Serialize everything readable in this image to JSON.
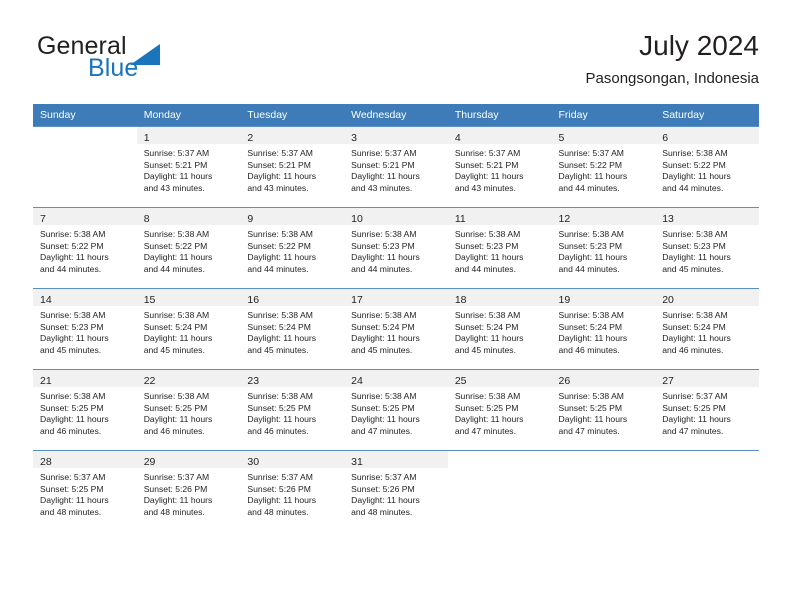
{
  "brand": {
    "name_top": "General",
    "name_bottom": "Blue",
    "colors": {
      "blue": "#1b75bb",
      "dark": "#231f20"
    }
  },
  "header": {
    "title": "July 2024",
    "subtitle": "Pasongsongan, Indonesia"
  },
  "theme": {
    "header_row_bg": "#3d7cb8",
    "daynum_band_bg": "#f1f1f1",
    "grid_line": "#5b8fc4",
    "text": "#231f20"
  },
  "weekday_headers": [
    "Sunday",
    "Monday",
    "Tuesday",
    "Wednesday",
    "Thursday",
    "Friday",
    "Saturday"
  ],
  "labels": {
    "sunrise_prefix": "Sunrise:",
    "sunset_prefix": "Sunset:",
    "daylight_prefix": "Daylight:"
  },
  "weeks": [
    [
      {
        "day": "",
        "blank": true
      },
      {
        "day": "1",
        "sunrise": "Sunrise: 5:37 AM",
        "sunset": "Sunset: 5:21 PM",
        "daylight1": "Daylight: 11 hours",
        "daylight2": "and 43 minutes."
      },
      {
        "day": "2",
        "sunrise": "Sunrise: 5:37 AM",
        "sunset": "Sunset: 5:21 PM",
        "daylight1": "Daylight: 11 hours",
        "daylight2": "and 43 minutes."
      },
      {
        "day": "3",
        "sunrise": "Sunrise: 5:37 AM",
        "sunset": "Sunset: 5:21 PM",
        "daylight1": "Daylight: 11 hours",
        "daylight2": "and 43 minutes."
      },
      {
        "day": "4",
        "sunrise": "Sunrise: 5:37 AM",
        "sunset": "Sunset: 5:21 PM",
        "daylight1": "Daylight: 11 hours",
        "daylight2": "and 43 minutes."
      },
      {
        "day": "5",
        "sunrise": "Sunrise: 5:37 AM",
        "sunset": "Sunset: 5:22 PM",
        "daylight1": "Daylight: 11 hours",
        "daylight2": "and 44 minutes."
      },
      {
        "day": "6",
        "sunrise": "Sunrise: 5:38 AM",
        "sunset": "Sunset: 5:22 PM",
        "daylight1": "Daylight: 11 hours",
        "daylight2": "and 44 minutes."
      }
    ],
    [
      {
        "day": "7",
        "sunrise": "Sunrise: 5:38 AM",
        "sunset": "Sunset: 5:22 PM",
        "daylight1": "Daylight: 11 hours",
        "daylight2": "and 44 minutes."
      },
      {
        "day": "8",
        "sunrise": "Sunrise: 5:38 AM",
        "sunset": "Sunset: 5:22 PM",
        "daylight1": "Daylight: 11 hours",
        "daylight2": "and 44 minutes."
      },
      {
        "day": "9",
        "sunrise": "Sunrise: 5:38 AM",
        "sunset": "Sunset: 5:22 PM",
        "daylight1": "Daylight: 11 hours",
        "daylight2": "and 44 minutes."
      },
      {
        "day": "10",
        "sunrise": "Sunrise: 5:38 AM",
        "sunset": "Sunset: 5:23 PM",
        "daylight1": "Daylight: 11 hours",
        "daylight2": "and 44 minutes."
      },
      {
        "day": "11",
        "sunrise": "Sunrise: 5:38 AM",
        "sunset": "Sunset: 5:23 PM",
        "daylight1": "Daylight: 11 hours",
        "daylight2": "and 44 minutes."
      },
      {
        "day": "12",
        "sunrise": "Sunrise: 5:38 AM",
        "sunset": "Sunset: 5:23 PM",
        "daylight1": "Daylight: 11 hours",
        "daylight2": "and 44 minutes."
      },
      {
        "day": "13",
        "sunrise": "Sunrise: 5:38 AM",
        "sunset": "Sunset: 5:23 PM",
        "daylight1": "Daylight: 11 hours",
        "daylight2": "and 45 minutes."
      }
    ],
    [
      {
        "day": "14",
        "sunrise": "Sunrise: 5:38 AM",
        "sunset": "Sunset: 5:23 PM",
        "daylight1": "Daylight: 11 hours",
        "daylight2": "and 45 minutes."
      },
      {
        "day": "15",
        "sunrise": "Sunrise: 5:38 AM",
        "sunset": "Sunset: 5:24 PM",
        "daylight1": "Daylight: 11 hours",
        "daylight2": "and 45 minutes."
      },
      {
        "day": "16",
        "sunrise": "Sunrise: 5:38 AM",
        "sunset": "Sunset: 5:24 PM",
        "daylight1": "Daylight: 11 hours",
        "daylight2": "and 45 minutes."
      },
      {
        "day": "17",
        "sunrise": "Sunrise: 5:38 AM",
        "sunset": "Sunset: 5:24 PM",
        "daylight1": "Daylight: 11 hours",
        "daylight2": "and 45 minutes."
      },
      {
        "day": "18",
        "sunrise": "Sunrise: 5:38 AM",
        "sunset": "Sunset: 5:24 PM",
        "daylight1": "Daylight: 11 hours",
        "daylight2": "and 45 minutes."
      },
      {
        "day": "19",
        "sunrise": "Sunrise: 5:38 AM",
        "sunset": "Sunset: 5:24 PM",
        "daylight1": "Daylight: 11 hours",
        "daylight2": "and 46 minutes."
      },
      {
        "day": "20",
        "sunrise": "Sunrise: 5:38 AM",
        "sunset": "Sunset: 5:24 PM",
        "daylight1": "Daylight: 11 hours",
        "daylight2": "and 46 minutes."
      }
    ],
    [
      {
        "day": "21",
        "sunrise": "Sunrise: 5:38 AM",
        "sunset": "Sunset: 5:25 PM",
        "daylight1": "Daylight: 11 hours",
        "daylight2": "and 46 minutes."
      },
      {
        "day": "22",
        "sunrise": "Sunrise: 5:38 AM",
        "sunset": "Sunset: 5:25 PM",
        "daylight1": "Daylight: 11 hours",
        "daylight2": "and 46 minutes."
      },
      {
        "day": "23",
        "sunrise": "Sunrise: 5:38 AM",
        "sunset": "Sunset: 5:25 PM",
        "daylight1": "Daylight: 11 hours",
        "daylight2": "and 46 minutes."
      },
      {
        "day": "24",
        "sunrise": "Sunrise: 5:38 AM",
        "sunset": "Sunset: 5:25 PM",
        "daylight1": "Daylight: 11 hours",
        "daylight2": "and 47 minutes."
      },
      {
        "day": "25",
        "sunrise": "Sunrise: 5:38 AM",
        "sunset": "Sunset: 5:25 PM",
        "daylight1": "Daylight: 11 hours",
        "daylight2": "and 47 minutes."
      },
      {
        "day": "26",
        "sunrise": "Sunrise: 5:38 AM",
        "sunset": "Sunset: 5:25 PM",
        "daylight1": "Daylight: 11 hours",
        "daylight2": "and 47 minutes."
      },
      {
        "day": "27",
        "sunrise": "Sunrise: 5:37 AM",
        "sunset": "Sunset: 5:25 PM",
        "daylight1": "Daylight: 11 hours",
        "daylight2": "and 47 minutes."
      }
    ],
    [
      {
        "day": "28",
        "sunrise": "Sunrise: 5:37 AM",
        "sunset": "Sunset: 5:25 PM",
        "daylight1": "Daylight: 11 hours",
        "daylight2": "and 48 minutes."
      },
      {
        "day": "29",
        "sunrise": "Sunrise: 5:37 AM",
        "sunset": "Sunset: 5:26 PM",
        "daylight1": "Daylight: 11 hours",
        "daylight2": "and 48 minutes."
      },
      {
        "day": "30",
        "sunrise": "Sunrise: 5:37 AM",
        "sunset": "Sunset: 5:26 PM",
        "daylight1": "Daylight: 11 hours",
        "daylight2": "and 48 minutes."
      },
      {
        "day": "31",
        "sunrise": "Sunrise: 5:37 AM",
        "sunset": "Sunset: 5:26 PM",
        "daylight1": "Daylight: 11 hours",
        "daylight2": "and 48 minutes."
      },
      {
        "day": "",
        "blank": true
      },
      {
        "day": "",
        "blank": true
      },
      {
        "day": "",
        "blank": true
      }
    ]
  ]
}
